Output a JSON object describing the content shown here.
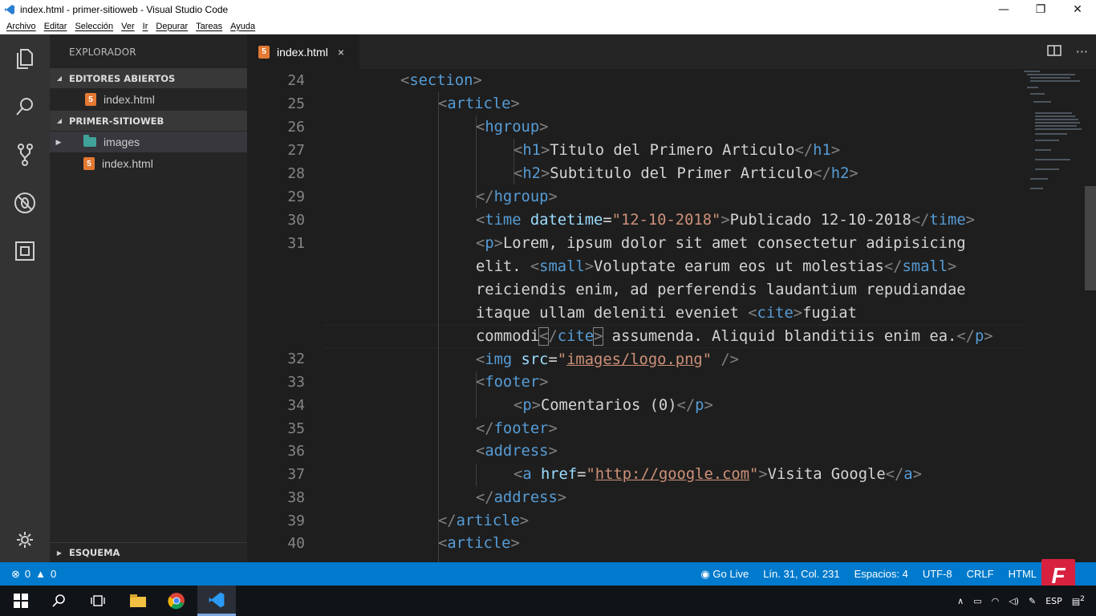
{
  "window": {
    "title": "index.html - primer-sitioweb - Visual Studio Code",
    "minimize": "—",
    "maximize": "❐",
    "close": "✕"
  },
  "menu": [
    "Archivo",
    "Editar",
    "Selección",
    "Ver",
    "Ir",
    "Depurar",
    "Tareas",
    "Ayuda"
  ],
  "sidebar": {
    "title": "EXPLORADOR",
    "open_editors": {
      "label": "EDITORES ABIERTOS",
      "files": [
        "index.html"
      ]
    },
    "project": {
      "label": "PRIMER-SITIOWEB",
      "folder": "images",
      "file": "index.html"
    },
    "outline": "ESQUEMA"
  },
  "tab": {
    "label": "index.html",
    "close": "×",
    "actions": [
      "split-editor-icon",
      "more-icon"
    ]
  },
  "line_numbers": [
    "24",
    "25",
    "26",
    "27",
    "28",
    "29",
    "30",
    "31",
    "",
    "",
    "",
    "",
    "32",
    "33",
    "34",
    "35",
    "36",
    "37",
    "38",
    "39",
    "40"
  ],
  "code": {
    "l24": {
      "tag": "section"
    },
    "l25": {
      "tag": "article"
    },
    "l26": {
      "tag": "hgroup"
    },
    "l27": {
      "tag": "h1",
      "text": "Titulo del Primero Articulo"
    },
    "l28": {
      "tag": "h2",
      "text": "Subtitulo del Primer Articulo"
    },
    "l29": {
      "tag": "hgroup"
    },
    "l30": {
      "tag": "time",
      "attr": "datetime",
      "value": "\"12-10-2018\"",
      "text": "Publicado 12-10-2018"
    },
    "l31a": {
      "tag": "p",
      "text": "Lorem, ipsum dolor sit amet consectetur adipisicing"
    },
    "l31b": {
      "text1": "elit. ",
      "small": "small",
      "small_text": "Voluptate earum eos ut molestias"
    },
    "l31c": {
      "text": "reiciendis enim, ad perferendis laudantium repudiandae"
    },
    "l31d": {
      "text": "itaque ullam deleniti eveniet ",
      "cite": "cite",
      "cite_text": "fugiat"
    },
    "l31e": {
      "text1": "commodi",
      "cite": "cite",
      "text2": " assumenda. Aliquid blanditiis enim ea.",
      "p": "p"
    },
    "l32": {
      "tag": "img",
      "attr": "src",
      "value": "images/logo.png"
    },
    "l33": {
      "tag": "footer"
    },
    "l34": {
      "tag": "p",
      "text": "Comentarios (0)"
    },
    "l35": {
      "tag": "footer"
    },
    "l36": {
      "tag": "address"
    },
    "l37": {
      "tag": "a",
      "attr": "href",
      "value": "http://google.com",
      "text": "Visita Google"
    },
    "l38": {
      "tag": "address"
    },
    "l39": {
      "tag": "article"
    },
    "l40": {
      "tag": "article"
    }
  },
  "status": {
    "errors": "0",
    "warnings": "0",
    "go_live": "Go Live",
    "position": "Lín. 31, Col. 231",
    "spaces": "Espacios: 4",
    "encoding": "UTF-8",
    "eol": "CRLF",
    "language": "HTML",
    "badge": "F"
  },
  "taskbar": {
    "lang": "ESP",
    "notifications": "2"
  },
  "colors": {
    "accent": "#007acc",
    "tag": "#569cd6",
    "attr": "#9cdcfe",
    "string": "#ce9178",
    "html_icon": "#e37933"
  }
}
